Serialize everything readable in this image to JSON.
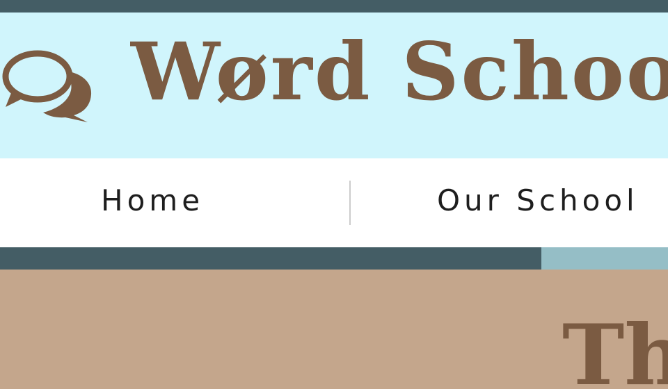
{
  "header": {
    "site_title": "Wørd School",
    "logo_icon": "speech-bubbles-icon"
  },
  "nav": {
    "items": [
      {
        "label": "Home"
      },
      {
        "label": "Our School"
      }
    ]
  },
  "hero": {
    "heading": "Th"
  },
  "colors": {
    "topbar": "#445d65",
    "banner_bg": "#d0f5fc",
    "brand_brown": "#7b5b42",
    "strip_dark": "#445d65",
    "strip_light": "#95bec6",
    "hero_bg": "#c4a68c",
    "nav_text": "#1e1e1e"
  }
}
